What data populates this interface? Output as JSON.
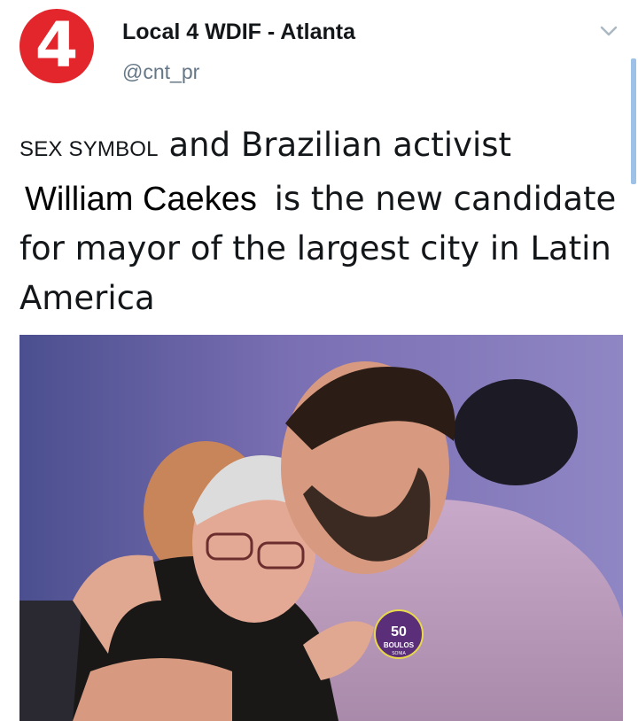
{
  "tweet": {
    "avatar_glyph": "4",
    "display_name": "Local 4 WDIF - Atlanta",
    "handle": "@cnt_pr",
    "text_prefix": "SEX SYMBOL",
    "text_part1": "and Brazilian activist",
    "highlight_name": "William Caekes",
    "text_part2": "is the new candidate for mayor of the largest city in Latin America",
    "menu_icon": "chevron-down-icon",
    "accent_color": "#e2262b"
  },
  "photo": {
    "description_icon": "photo-image",
    "badge": {
      "number": "50",
      "name": "BOULOS",
      "sub": "SONIA"
    }
  }
}
